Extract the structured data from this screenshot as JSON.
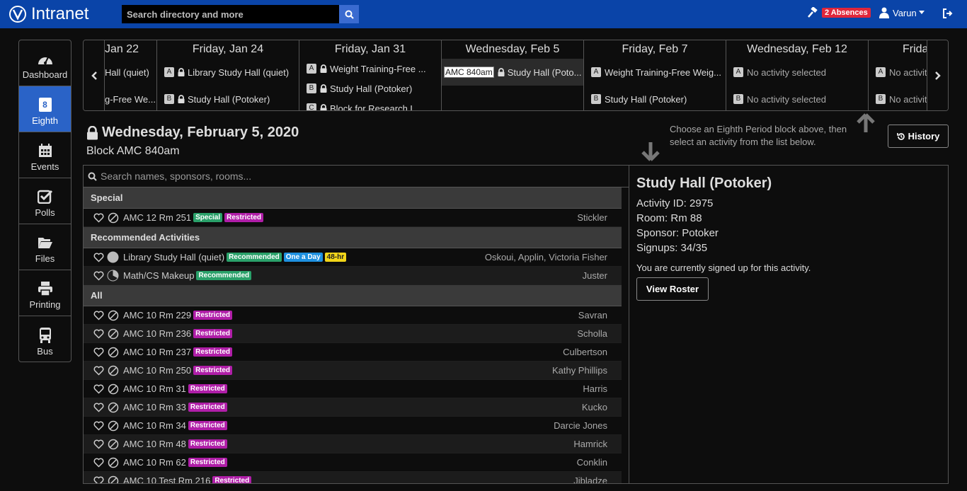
{
  "app": {
    "title": "Intranet"
  },
  "search": {
    "placeholder": "Search directory and more"
  },
  "header": {
    "absences_label": "2 Absences",
    "user_name": "Varun"
  },
  "sidenav": {
    "items": [
      {
        "label": "Dashboard",
        "icon": "dashboard-icon"
      },
      {
        "label": "Eighth",
        "icon": "eighth-icon",
        "badge": "8",
        "active": true
      },
      {
        "label": "Events",
        "icon": "calendar-icon"
      },
      {
        "label": "Polls",
        "icon": "check-square-icon"
      },
      {
        "label": "Files",
        "icon": "folder-icon"
      },
      {
        "label": "Printing",
        "icon": "printer-icon"
      },
      {
        "label": "Bus",
        "icon": "bus-icon"
      }
    ]
  },
  "days": [
    {
      "title": "Jan 22",
      "blocks": [
        {
          "text": "Hall (quiet)"
        },
        {
          "text": "g-Free We..."
        }
      ]
    },
    {
      "title": "Friday, Jan 24",
      "blocks": [
        {
          "letter": "A",
          "text": "Library Study Hall (quiet)"
        },
        {
          "letter": "B",
          "text": "Study Hall (Potoker)"
        }
      ]
    },
    {
      "title": "Friday, Jan 31",
      "blocks": [
        {
          "letter": "A",
          "text": "Weight Training-Free ..."
        },
        {
          "letter": "B",
          "text": "Study Hall (Potoker)"
        },
        {
          "letter": "C",
          "text": "Block for Research L..."
        }
      ]
    },
    {
      "title": "Wednesday, Feb 5",
      "blocks": [
        {
          "tag": "AMC 840am",
          "text": "Study Hall (Poto..."
        }
      ]
    },
    {
      "title": "Friday, Feb 7",
      "blocks": [
        {
          "letter": "A",
          "text": "Weight Training-Free Weig..."
        },
        {
          "letter": "B",
          "text": "Study Hall (Potoker)"
        }
      ]
    },
    {
      "title": "Wednesday, Feb 12",
      "blocks": [
        {
          "letter": "A",
          "text": "No activity selected"
        },
        {
          "letter": "B",
          "text": "No activity selected"
        }
      ]
    },
    {
      "title": "Friday",
      "blocks": [
        {
          "letter": "A",
          "text": "No activity"
        },
        {
          "letter": "B",
          "text": "No activity"
        }
      ]
    }
  ],
  "page": {
    "date_title": "Wednesday, February 5, 2020",
    "block_label": "Block AMC 840am",
    "hint": "Choose an Eighth Period block above, then select an activity from the list below.",
    "history_label": "History"
  },
  "list": {
    "search_placeholder": "Search names, sponsors, rooms...",
    "sections": [
      {
        "title": "Special",
        "rows": [
          {
            "name": "AMC 12 Rm 251",
            "tags": [
              "Special",
              "Restricted"
            ],
            "sponsor": "Stickler",
            "status": "blocked"
          }
        ]
      },
      {
        "title": "Recommended Activities",
        "rows": [
          {
            "name": "Library Study Hall (quiet)",
            "tags": [
              "Recommended",
              "One a Day",
              "48-hr"
            ],
            "sponsor": "Oskoui, Applin, Victoria Fisher",
            "status": "full"
          },
          {
            "name": "Math/CS Makeup",
            "tags": [
              "Recommended"
            ],
            "sponsor": "Juster",
            "status": "partial"
          }
        ]
      },
      {
        "title": "All",
        "rows": [
          {
            "name": "AMC 10 Rm 229",
            "tags": [
              "Restricted"
            ],
            "sponsor": "Savran",
            "status": "blocked"
          },
          {
            "name": "AMC 10 Rm 236",
            "tags": [
              "Restricted"
            ],
            "sponsor": "Scholla",
            "status": "blocked"
          },
          {
            "name": "AMC 10 Rm 237",
            "tags": [
              "Restricted"
            ],
            "sponsor": "Culbertson",
            "status": "blocked"
          },
          {
            "name": "AMC 10 Rm 250",
            "tags": [
              "Restricted"
            ],
            "sponsor": "Kathy Phillips",
            "status": "blocked"
          },
          {
            "name": "AMC 10 Rm 31",
            "tags": [
              "Restricted"
            ],
            "sponsor": "Harris",
            "status": "blocked"
          },
          {
            "name": "AMC 10 Rm 33",
            "tags": [
              "Restricted"
            ],
            "sponsor": "Kucko",
            "status": "blocked"
          },
          {
            "name": "AMC 10 Rm 34",
            "tags": [
              "Restricted"
            ],
            "sponsor": "Darcie Jones",
            "status": "blocked"
          },
          {
            "name": "AMC 10 Rm 48",
            "tags": [
              "Restricted"
            ],
            "sponsor": "Hamrick",
            "status": "blocked"
          },
          {
            "name": "AMC 10 Rm 62",
            "tags": [
              "Restricted"
            ],
            "sponsor": "Conklin",
            "status": "blocked"
          },
          {
            "name": "AMC 10 Test Rm 216",
            "tags": [
              "Restricted"
            ],
            "sponsor": "Jibladze",
            "status": "blocked"
          }
        ]
      }
    ]
  },
  "detail": {
    "title": "Study Hall (Potoker)",
    "props": [
      {
        "label": "Activity ID:",
        "value": "2975"
      },
      {
        "label": "Room:",
        "value": "Rm 88"
      },
      {
        "label": "Sponsor:",
        "value": "Potoker"
      },
      {
        "label": "Signups:",
        "value": "34/35"
      }
    ],
    "signed_up_text": "You are currently signed up for this activity.",
    "roster_label": "View Roster"
  },
  "colors": {
    "topbar": "#0a44a8",
    "active_nav": "#2a63c7",
    "restricted": "#b01ea8",
    "special": "#2aa16a",
    "one_a_day": "#1e90e0",
    "hr48": "#f2d519",
    "absence_badge": "#e0273b"
  }
}
